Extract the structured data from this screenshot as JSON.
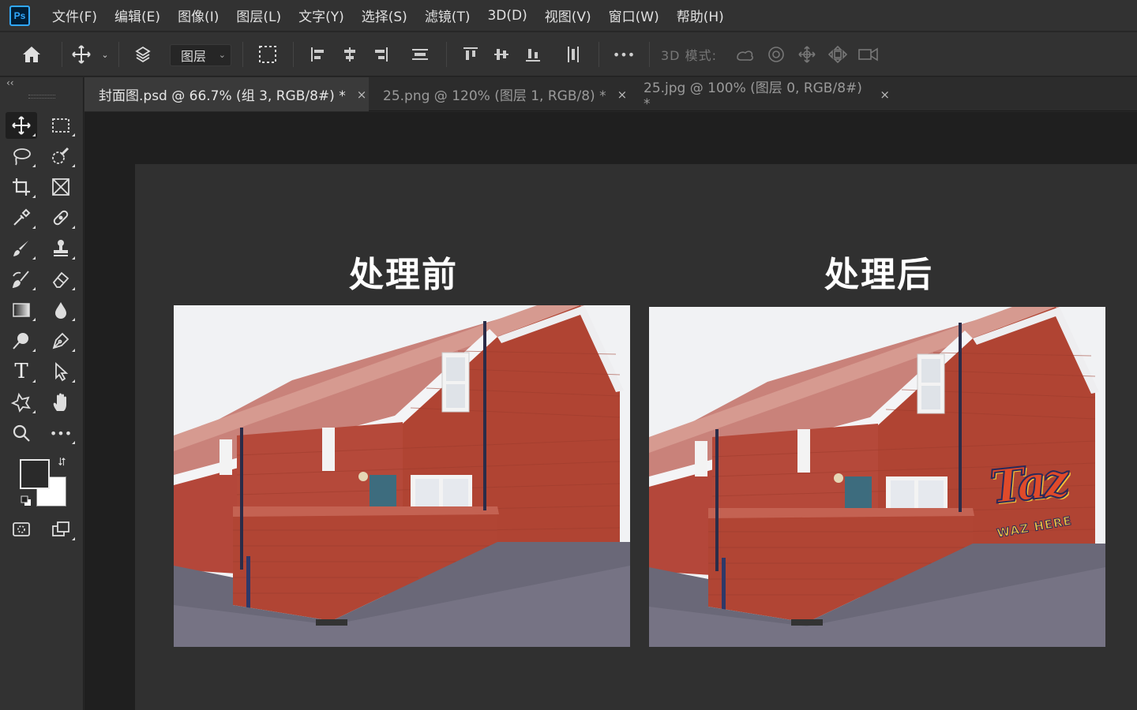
{
  "app": {
    "logo": "Ps"
  },
  "menu": [
    {
      "label": "文件(F)"
    },
    {
      "label": "编辑(E)"
    },
    {
      "label": "图像(I)"
    },
    {
      "label": "图层(L)"
    },
    {
      "label": "文字(Y)"
    },
    {
      "label": "选择(S)"
    },
    {
      "label": "滤镜(T)"
    },
    {
      "label": "3D(D)"
    },
    {
      "label": "视图(V)"
    },
    {
      "label": "窗口(W)"
    },
    {
      "label": "帮助(H)"
    }
  ],
  "options": {
    "auto_select_target": "图层",
    "mode_3d_label": "3D 模式:",
    "more_label": "•••"
  },
  "tabs": [
    {
      "label": "封面图.psd @ 66.7% (组 3, RGB/8#) *",
      "close": "×",
      "active": true
    },
    {
      "label": "25.png @ 120% (图层 1, RGB/8) *",
      "close": "×",
      "active": false
    },
    {
      "label": "25.jpg @ 100% (图层 0, RGB/8#) *",
      "close": "×",
      "active": false
    }
  ],
  "toolbar": {
    "collapse": "‹‹",
    "tools": [
      "move-tool",
      "marquee-tool",
      "lasso-tool",
      "quick-select-tool",
      "crop-tool",
      "frame-tool",
      "eyedropper-tool",
      "healing-brush-tool",
      "brush-tool",
      "clone-stamp-tool",
      "history-brush-tool",
      "eraser-tool",
      "gradient-tool",
      "blur-tool",
      "dodge-tool",
      "pen-tool",
      "type-tool",
      "path-select-tool",
      "custom-shape-tool",
      "hand-tool",
      "zoom-tool",
      "more-tools"
    ],
    "type_glyph": "T",
    "more_glyph": "•••",
    "swap_glyph": "⮃",
    "foreground_color": "#2a2a2a",
    "background_color": "#ffffff"
  },
  "canvas": {
    "before_title": "处理前",
    "after_title": "处理后",
    "graffiti_main": "Taz",
    "graffiti_sub": "WAZ HERE"
  },
  "colors": {
    "accent": "#31a8ff",
    "menubar": "#323232",
    "workspace": "#1f1f1f",
    "canvas": "#303030"
  }
}
